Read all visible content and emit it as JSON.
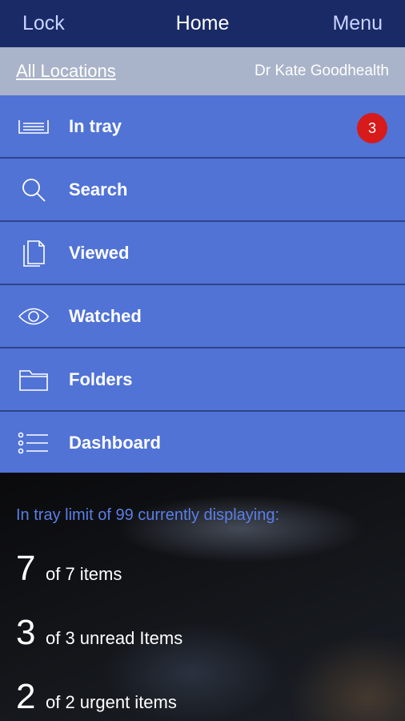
{
  "header": {
    "left": "Lock",
    "title": "Home",
    "right": "Menu"
  },
  "location": {
    "link": "All Locations",
    "user": "Dr Kate Goodhealth"
  },
  "menu": [
    {
      "label": "In tray",
      "icon": "tray-icon",
      "badge": "3"
    },
    {
      "label": "Search",
      "icon": "search-icon"
    },
    {
      "label": "Viewed",
      "icon": "document-icon"
    },
    {
      "label": "Watched",
      "icon": "eye-icon"
    },
    {
      "label": "Folders",
      "icon": "folder-icon"
    },
    {
      "label": "Dashboard",
      "icon": "list-icon"
    }
  ],
  "summary": {
    "limit_text": "In tray limit of 99 currently displaying:",
    "stats": [
      {
        "num": "7",
        "text": "of 7 items"
      },
      {
        "num": "3",
        "text": "of 3 unread Items"
      },
      {
        "num": "2",
        "text": "of 2 urgent items"
      }
    ]
  },
  "colors": {
    "header": "#1a2a66",
    "location_bar": "#a9b3c9",
    "menu_bg": "#5173d6",
    "badge": "#d71a1a",
    "accent_text": "#5b7fe6"
  }
}
